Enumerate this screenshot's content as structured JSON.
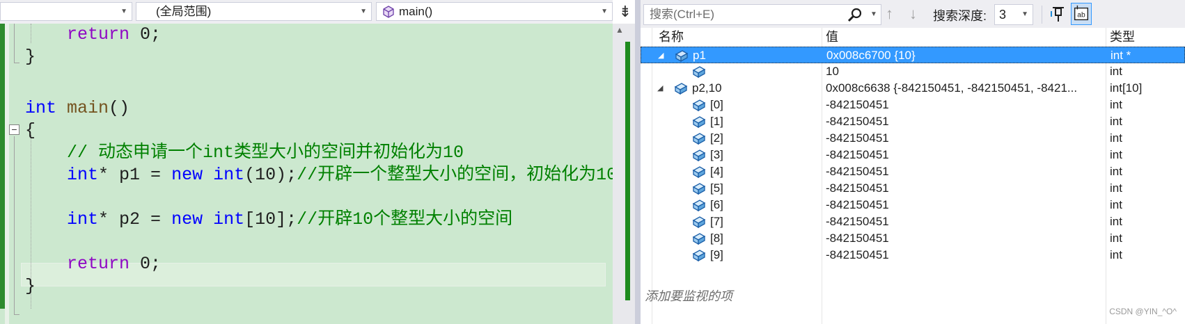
{
  "editor": {
    "nav": {
      "project": "",
      "scope": "(全局范围)",
      "member": "main()"
    },
    "code_lines": [
      {
        "indent": "    ",
        "tokens": [
          {
            "t": "return",
            "c": "kw2"
          },
          {
            "t": " 0;",
            "c": ""
          }
        ]
      },
      {
        "indent": "",
        "tokens": [
          {
            "t": "}",
            "c": ""
          }
        ]
      },
      {
        "indent": "",
        "tokens": []
      },
      {
        "indent": "",
        "tokens": [
          {
            "t": "int",
            "c": "kw"
          },
          {
            "t": " ",
            "c": ""
          },
          {
            "t": "main",
            "c": "fn"
          },
          {
            "t": "()",
            "c": ""
          }
        ]
      },
      {
        "indent": "",
        "tokens": [
          {
            "t": "{",
            "c": ""
          }
        ]
      },
      {
        "indent": "    ",
        "tokens": [
          {
            "t": "// 动态申请一个int类型大小的空间并初始化为10",
            "c": "cm"
          }
        ]
      },
      {
        "indent": "    ",
        "tokens": [
          {
            "t": "int",
            "c": "kw"
          },
          {
            "t": "* p1 = ",
            "c": ""
          },
          {
            "t": "new",
            "c": "kw"
          },
          {
            "t": " ",
            "c": ""
          },
          {
            "t": "int",
            "c": "kw"
          },
          {
            "t": "(10);",
            "c": ""
          },
          {
            "t": "//开辟一个整型大小的空间，初始化为10",
            "c": "cm"
          }
        ]
      },
      {
        "indent": "",
        "tokens": []
      },
      {
        "indent": "    ",
        "tokens": [
          {
            "t": "int",
            "c": "kw"
          },
          {
            "t": "* p2 = ",
            "c": ""
          },
          {
            "t": "new",
            "c": "kw"
          },
          {
            "t": " ",
            "c": ""
          },
          {
            "t": "int",
            "c": "kw"
          },
          {
            "t": "[10];",
            "c": ""
          },
          {
            "t": "//开辟10个整型大小的空间",
            "c": "cm"
          }
        ]
      },
      {
        "indent": "",
        "tokens": []
      },
      {
        "indent": "    ",
        "tokens": [
          {
            "t": "return",
            "c": "kw2"
          },
          {
            "t": " 0;",
            "c": ""
          }
        ]
      },
      {
        "indent": "",
        "tokens": [
          {
            "t": "}",
            "c": ""
          }
        ]
      }
    ]
  },
  "watch": {
    "search_placeholder": "搜索(Ctrl+E)",
    "depth_label": "搜索深度:",
    "depth_value": "3",
    "columns": {
      "name": "名称",
      "value": "值",
      "type": "类型"
    },
    "rows": [
      {
        "level": 0,
        "expander": "◢",
        "name": "p1",
        "value": "0x008c6700 {10}",
        "type": "int *",
        "selected": true
      },
      {
        "level": 1,
        "expander": "",
        "name": "",
        "value": "10",
        "type": "int",
        "selected": false
      },
      {
        "level": 0,
        "expander": "◢",
        "name": "p2,10",
        "value": "0x008c6638 {-842150451, -842150451, -8421...",
        "type": "int[10]",
        "selected": false
      },
      {
        "level": 1,
        "expander": "",
        "name": "[0]",
        "value": "-842150451",
        "type": "int",
        "selected": false
      },
      {
        "level": 1,
        "expander": "",
        "name": "[1]",
        "value": "-842150451",
        "type": "int",
        "selected": false
      },
      {
        "level": 1,
        "expander": "",
        "name": "[2]",
        "value": "-842150451",
        "type": "int",
        "selected": false
      },
      {
        "level": 1,
        "expander": "",
        "name": "[3]",
        "value": "-842150451",
        "type": "int",
        "selected": false
      },
      {
        "level": 1,
        "expander": "",
        "name": "[4]",
        "value": "-842150451",
        "type": "int",
        "selected": false
      },
      {
        "level": 1,
        "expander": "",
        "name": "[5]",
        "value": "-842150451",
        "type": "int",
        "selected": false
      },
      {
        "level": 1,
        "expander": "",
        "name": "[6]",
        "value": "-842150451",
        "type": "int",
        "selected": false
      },
      {
        "level": 1,
        "expander": "",
        "name": "[7]",
        "value": "-842150451",
        "type": "int",
        "selected": false
      },
      {
        "level": 1,
        "expander": "",
        "name": "[8]",
        "value": "-842150451",
        "type": "int",
        "selected": false
      },
      {
        "level": 1,
        "expander": "",
        "name": "[9]",
        "value": "-842150451",
        "type": "int",
        "selected": false
      }
    ],
    "add_item_text": "添加要监视的项"
  },
  "watermark": "CSDN @YIN_^O^",
  "icons": {
    "member": "method-cube-icon",
    "search": "magnifier-icon",
    "pin": "pin-icon",
    "hex": "hex-display-icon",
    "variable": "field-variable-icon",
    "split": "split-window-icon"
  },
  "colors": {
    "code_background": "#cce8cf",
    "selection": "#3399ff",
    "keyword": "#0000ff",
    "control_keyword": "#8f08c4",
    "comment": "#008000",
    "change_bar": "#2e8b2e"
  }
}
